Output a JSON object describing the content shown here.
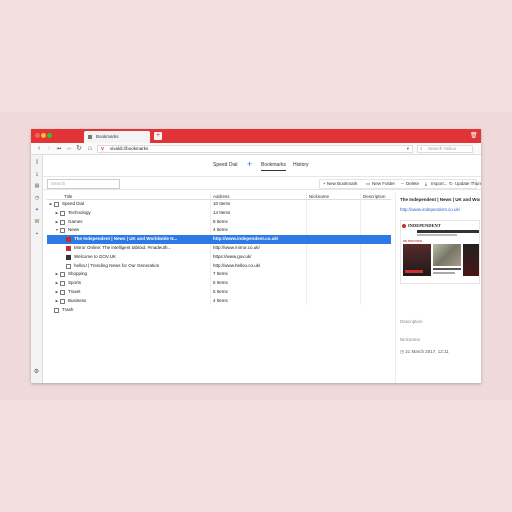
{
  "browser": {
    "tab_title": "Bookmarks",
    "new_tab": "+",
    "close_icon": "🗑",
    "url": "vivaldi://bookmarks",
    "search_placeholder": "Search Yahoo",
    "v_logo": "V"
  },
  "nav": {
    "back": "‹",
    "forward": "›",
    "rewind": "⏮",
    "fastforward": "⏭",
    "reload": "↻",
    "home": "⌂"
  },
  "subtabs": {
    "speed_dial": "Speed Dial",
    "add": "+",
    "bookmarks": "Bookmarks",
    "history": "History"
  },
  "toolbar": {
    "search_placeholder": "Search",
    "new_bookmark": "+ New Bookmark",
    "new_folder": "New Folder",
    "delete": "Delete",
    "import": "Import...",
    "update_thumbnails": "Update Thumbnails"
  },
  "table": {
    "headers": [
      "Title",
      "Address",
      "Nickname",
      "Description"
    ],
    "rows": [
      {
        "title": "Speed Dial",
        "address": "10 Items",
        "type": "folder",
        "indent": 0,
        "expand": "▶"
      },
      {
        "title": "Technology",
        "address": "14 Items",
        "type": "folder",
        "indent": 1,
        "expand": "▶"
      },
      {
        "title": "Games",
        "address": "8 Items",
        "type": "folder",
        "indent": 1,
        "expand": "▶"
      },
      {
        "title": "News",
        "address": "4 Items",
        "type": "folder",
        "indent": 1,
        "expand": "▼"
      },
      {
        "title": "The Independent | News | UK and Worldwide N...",
        "address": "http://www.independent.co.uk/",
        "type": "fav-red",
        "indent": 2,
        "expand": "",
        "selected": true
      },
      {
        "title": "Mirror Online: The intelligent tabloid. #madeuth...",
        "address": "http://www.mirror.co.uk/",
        "type": "fav-red",
        "indent": 2,
        "expand": ""
      },
      {
        "title": "Welcome to GOV.UK",
        "address": "https://www.gov.uk/",
        "type": "fav",
        "indent": 2,
        "expand": ""
      },
      {
        "title": "helloU | Trending News for Our Generation",
        "address": "http://www.hellou.co.uk/",
        "type": "page",
        "indent": 2,
        "expand": ""
      },
      {
        "title": "Shopping",
        "address": "7 Items",
        "type": "folder",
        "indent": 1,
        "expand": "▶"
      },
      {
        "title": "Sports",
        "address": "5 Items",
        "type": "folder",
        "indent": 1,
        "expand": "▶"
      },
      {
        "title": "Travel",
        "address": "5 Items",
        "type": "folder",
        "indent": 1,
        "expand": "▶"
      },
      {
        "title": "Business",
        "address": "4 Items",
        "type": "folder",
        "indent": 1,
        "expand": "▶"
      },
      {
        "title": "Trash",
        "address": "",
        "type": "trash",
        "indent": 0,
        "expand": ""
      }
    ]
  },
  "details": {
    "title": "The Independent | News | UK and Worl...",
    "url": "http://www.independent.co.uk/",
    "thumbnail_logo": "INDEPENDENT",
    "thumbnail_section": "UK POLITICS",
    "description_label": "Description",
    "nickname_label": "Nickname",
    "date": "21 March 2017, 12:11"
  },
  "colors": {
    "titlebar": "#e03437",
    "selection": "#2c7ae5",
    "link": "#2a63c9"
  }
}
